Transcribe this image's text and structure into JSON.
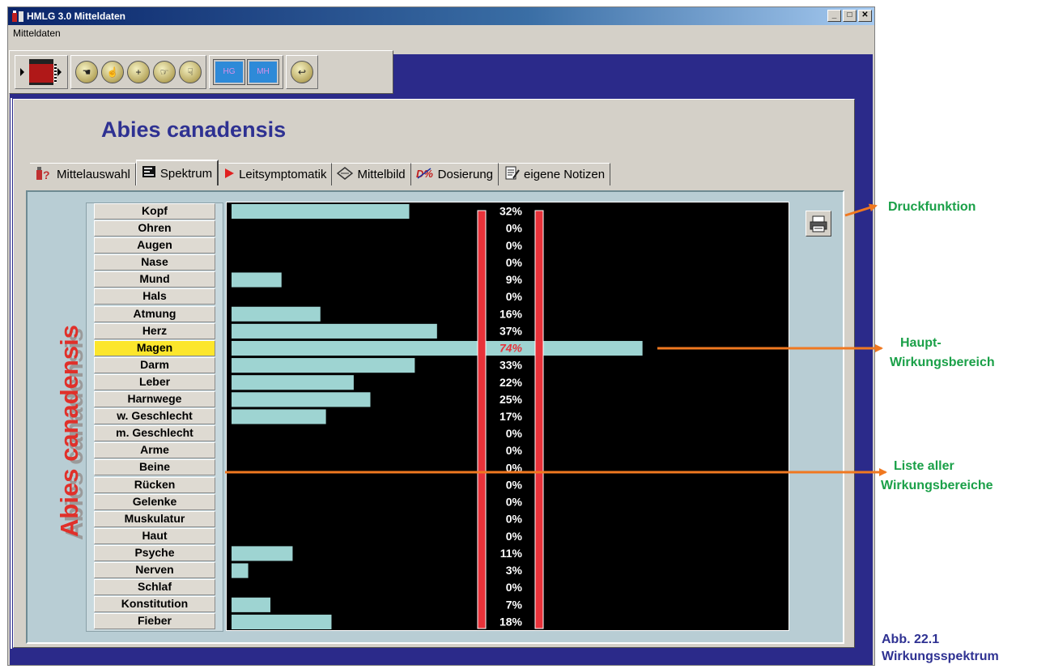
{
  "window": {
    "title": "HMLG 3.0 Mitteldaten",
    "minimize": "_",
    "maximize": "□",
    "close": "✕"
  },
  "menu": {
    "items": [
      "Mitteldaten"
    ]
  },
  "toolbar": {
    "btn_hg": "HG",
    "btn_mh": "MH",
    "btn_plus": "+"
  },
  "remedy": {
    "name": "Abies canadensis",
    "vertical_name": "Abies canadensis"
  },
  "tabs": [
    {
      "label": "Mittelauswahl",
      "icon": "bottle-question-icon"
    },
    {
      "label": "Spektrum",
      "icon": "spectrum-icon"
    },
    {
      "label": "Leitsymptomatik",
      "icon": "red-triangle-icon"
    },
    {
      "label": "Mittelbild",
      "icon": "diamond-icon"
    },
    {
      "label": "Dosierung",
      "icon": "dosage-icon"
    },
    {
      "label": "eigene Notizen",
      "icon": "notes-icon"
    }
  ],
  "chart_data": {
    "type": "bar",
    "orientation": "horizontal",
    "categories": [
      "Kopf",
      "Ohren",
      "Augen",
      "Nase",
      "Mund",
      "Hals",
      "Atmung",
      "Herz",
      "Magen",
      "Darm",
      "Leber",
      "Harnwege",
      "w. Geschlecht",
      "m. Geschlecht",
      "Arme",
      "Beine",
      "Rücken",
      "Gelenke",
      "Muskulatur",
      "Haut",
      "Psyche",
      "Nerven",
      "Schlaf",
      "Konstitution",
      "Fieber"
    ],
    "values": [
      32,
      0,
      0,
      0,
      9,
      0,
      16,
      37,
      74,
      33,
      22,
      25,
      17,
      0,
      0,
      0,
      0,
      0,
      0,
      0,
      11,
      3,
      0,
      7,
      18
    ],
    "labels": [
      "32%",
      "0%",
      "0%",
      "0%",
      "9%",
      "0%",
      "16%",
      "37%",
      "74%",
      "33%",
      "22%",
      "25%",
      "17%",
      "0%",
      "0%",
      "0%",
      "0%",
      "0%",
      "0%",
      "0%",
      "11%",
      "3%",
      "0%",
      "7%",
      "18%"
    ],
    "highlight_index": 8,
    "xlim": [
      0,
      100
    ],
    "colors": {
      "bar": "#9ed4d2",
      "background": "#000000",
      "label": "#ffffff",
      "highlight_label": "#e8323a",
      "marker": "#e8323a",
      "selected_row": "#fce62c"
    }
  },
  "annotations": {
    "print": "Druckfunktion",
    "main_1": "Haupt-",
    "main_2": "Wirkungsbereich",
    "list_1": "Liste aller",
    "list_2": "Wirkungsbereiche",
    "fig_1": "Abb. 22.1",
    "fig_2": "Wirkungsspektrum",
    "arrow_color": "#f07820",
    "text_color": "#1aa048"
  }
}
